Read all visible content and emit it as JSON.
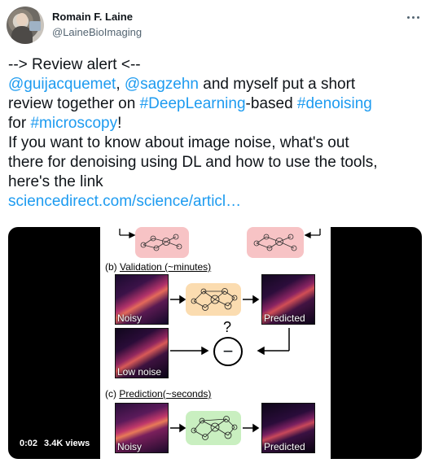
{
  "author": {
    "name": "Romain F. Laine",
    "handle": "@LaineBioImaging"
  },
  "tweet": {
    "line1": "--> Review alert <--",
    "mention1": "@guijacquemet",
    "sep1": ", ",
    "mention2": "@sagzehn",
    "text2": " and myself put a short",
    "text3a": "review together on ",
    "hashtag1": "#DeepLearning",
    "text3b": "-based ",
    "hashtag2": "#denoising",
    "text4a": "for ",
    "hashtag3": "#microscopy",
    "text4b": "!",
    "line5": "If you want to know about image noise, what's out",
    "line6": "there for denoising using DL and how to use the tools,",
    "line7": "here's the link",
    "link": "sciencedirect.com/science/articl…"
  },
  "media": {
    "time": "0:02",
    "views": "3.4K views",
    "figure": {
      "section_b": "(b) Validation (~minutes)",
      "section_b_prefix": "(b) ",
      "section_b_title": "Validation (~minutes)",
      "section_c_prefix": "(c) ",
      "section_c_title": "Prediction(~seconds)",
      "noisy": "Noisy",
      "predicted": "Predicted",
      "low_noise": "Low noise",
      "question": "?",
      "minus": "−"
    }
  },
  "colors": {
    "link": "#1d9bf0",
    "net_pink": "#f7c3c5",
    "net_orange": "#fbdcb0",
    "net_green": "#c9efc0"
  }
}
